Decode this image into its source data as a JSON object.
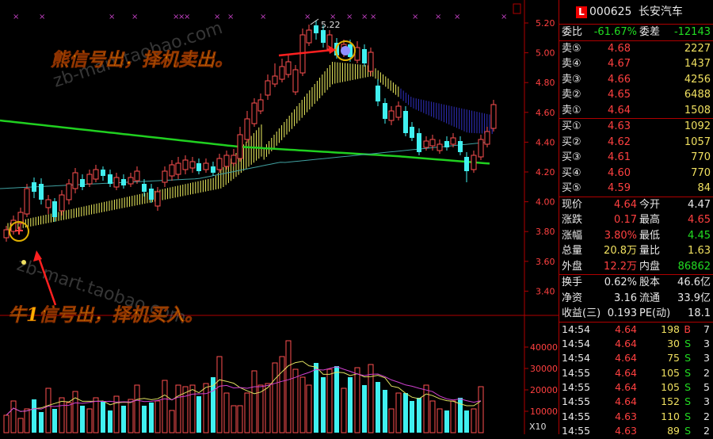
{
  "stock": {
    "code": "000625",
    "name": "长安汽车",
    "badge": "L"
  },
  "weibi": {
    "label1": "委比",
    "value1": "-61.67%",
    "label2": "委差",
    "value2": "-12143"
  },
  "sell": [
    {
      "label": "卖⑤",
      "price": "4.68",
      "vol": "2227"
    },
    {
      "label": "卖④",
      "price": "4.67",
      "vol": "1437"
    },
    {
      "label": "卖③",
      "price": "4.66",
      "vol": "4256"
    },
    {
      "label": "卖②",
      "price": "4.65",
      "vol": "6488"
    },
    {
      "label": "卖①",
      "price": "4.64",
      "vol": "1508"
    }
  ],
  "buy": [
    {
      "label": "买①",
      "price": "4.63",
      "vol": "1092"
    },
    {
      "label": "买②",
      "price": "4.62",
      "vol": "1057"
    },
    {
      "label": "买③",
      "price": "4.61",
      "vol": "770"
    },
    {
      "label": "买④",
      "price": "4.60",
      "vol": "770"
    },
    {
      "label": "买⑤",
      "price": "4.59",
      "vol": "84"
    }
  ],
  "quote": [
    {
      "l1": "现价",
      "v1": "4.64",
      "l2": "今开",
      "v2": "4.47",
      "c1": "red",
      "c2": "white"
    },
    {
      "l1": "涨跌",
      "v1": "0.17",
      "l2": "最高",
      "v2": "4.65",
      "c1": "red",
      "c2": "red"
    },
    {
      "l1": "涨幅",
      "v1": "3.80%",
      "l2": "最低",
      "v2": "4.45",
      "c1": "red",
      "c2": "green"
    },
    {
      "l1": "总量",
      "v1": "20.8万",
      "l2": "量比",
      "v2": "1.63",
      "c1": "yellow",
      "c2": "yellow"
    },
    {
      "l1": "外盘",
      "v1": "12.2万",
      "l2": "内盘",
      "v2": "86862",
      "c1": "red",
      "c2": "green"
    }
  ],
  "fund": [
    {
      "l1": "换手",
      "v1": "0.62%",
      "l2": "股本",
      "v2": "46.6亿"
    },
    {
      "l1": "净资",
      "v1": "3.16",
      "l2": "流通",
      "v2": "33.9亿"
    },
    {
      "l1": "收益(三)",
      "v1": "0.193",
      "l2": "PE(动)",
      "v2": "18.1"
    }
  ],
  "ticks": [
    {
      "time": "14:54",
      "price": "4.64",
      "vol": "198",
      "side": "B",
      "n": "7"
    },
    {
      "time": "14:54",
      "price": "4.64",
      "vol": "30",
      "side": "S",
      "n": "3"
    },
    {
      "time": "14:54",
      "price": "4.64",
      "vol": "75",
      "side": "S",
      "n": "3"
    },
    {
      "time": "14:55",
      "price": "4.64",
      "vol": "105",
      "side": "S",
      "n": "2"
    },
    {
      "time": "14:55",
      "price": "4.64",
      "vol": "105",
      "side": "S",
      "n": "5"
    },
    {
      "time": "14:55",
      "price": "4.64",
      "vol": "152",
      "side": "S",
      "n": "3"
    },
    {
      "time": "14:55",
      "price": "4.63",
      "vol": "110",
      "side": "S",
      "n": "2"
    },
    {
      "time": "14:55",
      "price": "4.63",
      "vol": "89",
      "side": "S",
      "n": "2"
    }
  ],
  "chart": {
    "price_axis": [
      "5.20",
      "5.00",
      "4.80",
      "4.60",
      "4.40",
      "4.20",
      "4.00",
      "3.80",
      "3.60",
      "3.40"
    ],
    "vol_axis": [
      "40000",
      "30000",
      "20000",
      "10000"
    ],
    "vol_unit": "X10",
    "high_label": "5.22",
    "annotation_sell": "熊信号出，择机卖出。",
    "annotation_buy": "牛1信号出，择机买入。",
    "watermark": "zb-mart.taobao.com",
    "colors": {
      "up": "#ff5050",
      "down": "#40f0f0",
      "ribbon_up": "#f0f060",
      "ribbon_down": "#3030c0",
      "ma_green": "#20d020",
      "ma_cyan": "#40a0a0"
    }
  }
}
